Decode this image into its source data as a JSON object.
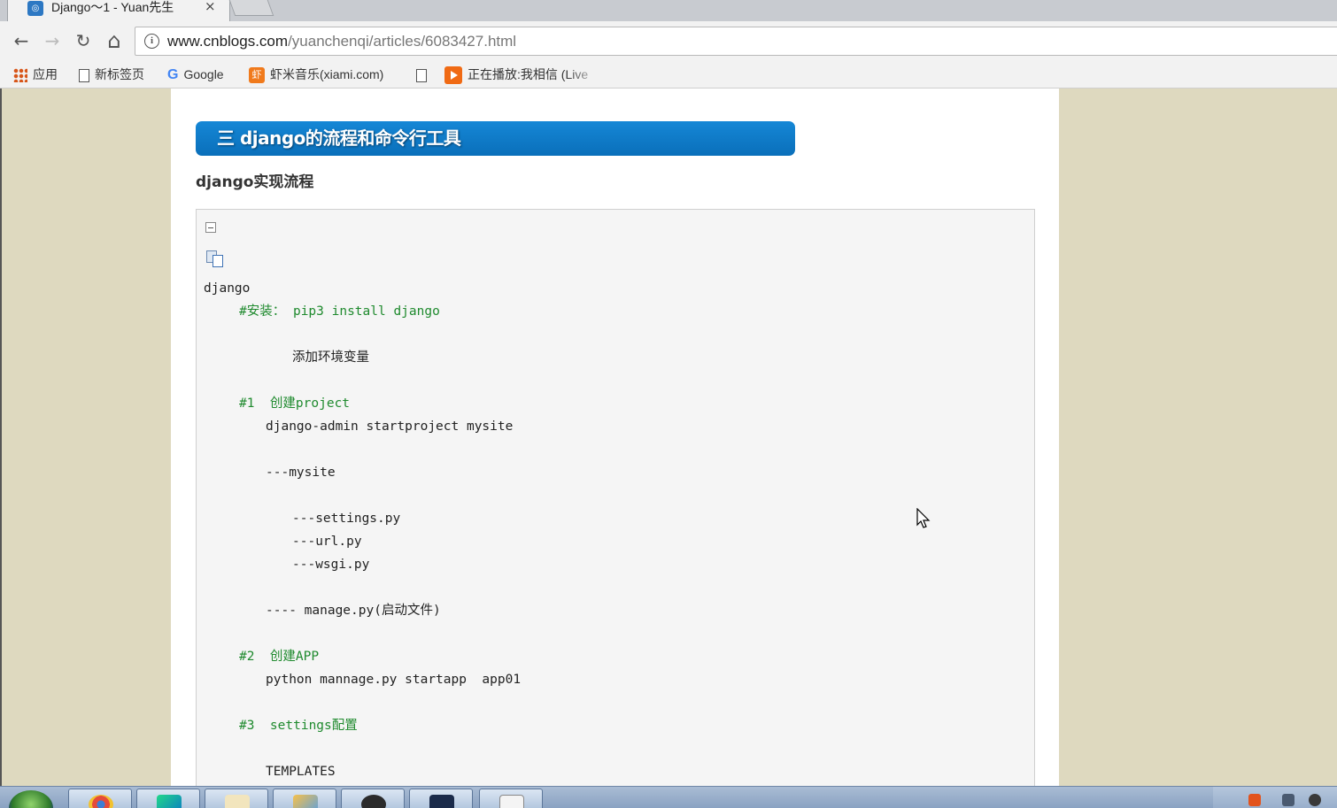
{
  "browser": {
    "tab": {
      "title": "Django～1 - Yuan先生",
      "close_glyph": "×",
      "favicon": "page-icon"
    },
    "nav": {
      "back_glyph": "←",
      "forward_glyph": "→",
      "reload_glyph": "↻",
      "home_glyph": "⌂"
    },
    "address": {
      "host": "www.cnblogs.com",
      "path": "/yuanchenqi/articles/6083427.html",
      "info_glyph": "i"
    },
    "bookmarks": [
      {
        "label": "应用",
        "icon": "apps-icon"
      },
      {
        "label": "新标签页",
        "icon": "page-icon"
      },
      {
        "label": "Google",
        "icon": "google-icon",
        "glyph": "G"
      },
      {
        "label": "虾米音乐(xiami.com)",
        "icon": "xiami-icon",
        "glyph": "虾"
      },
      {
        "label": "",
        "icon": "page-icon"
      },
      {
        "label": "正在播放:我相信 (Live",
        "icon": "play-icon"
      }
    ]
  },
  "article": {
    "section_title": "三 django的流程和命令行工具",
    "sub_heading": "django实现流程",
    "code": {
      "lines": [
        {
          "text": "django",
          "indent": 0,
          "comment": false
        },
        {
          "text": "#安装： pip3 install django",
          "indent": 1,
          "comment": true
        },
        {
          "text": "添加环境变量",
          "indent": 2,
          "comment": false
        },
        {
          "text": "#1  创建project",
          "indent": 1,
          "comment": true
        },
        {
          "text": "django-admin startproject mysite",
          "indent": 1.5,
          "comment": false
        },
        {
          "text": "---mysite",
          "indent": 1.5,
          "comment": false
        },
        {
          "text": "---settings.py",
          "indent": 2,
          "comment": false
        },
        {
          "text": "---url.py",
          "indent": 2,
          "comment": false
        },
        {
          "text": "---wsgi.py",
          "indent": 2,
          "comment": false
        },
        {
          "text": "---- manage.py(启动文件)",
          "indent": 1.5,
          "comment": false
        },
        {
          "text": "#2  创建APP",
          "indent": 1,
          "comment": true
        },
        {
          "text": "python mannage.py startapp  app01",
          "indent": 1.5,
          "comment": false
        },
        {
          "text": "#3  settings配置",
          "indent": 1,
          "comment": true
        },
        {
          "text": "TEMPLATES",
          "indent": 1.5,
          "comment": false
        }
      ]
    }
  },
  "colors": {
    "page_background": "#ded9bf",
    "title_bar": "#0a7ac8",
    "comment": "#1f8a2e",
    "code_background": "#f5f5f5"
  },
  "taskbar": {
    "items": [
      "chrome-icon",
      "pycharm-icon",
      "folder-icon",
      "paint-icon",
      "avatar-icon",
      "terminal-icon",
      "notepad-icon"
    ]
  }
}
